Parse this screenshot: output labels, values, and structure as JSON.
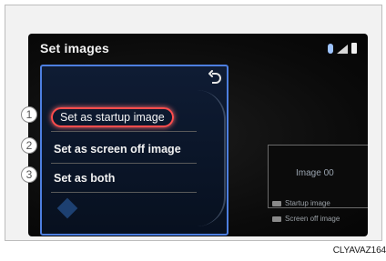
{
  "screen": {
    "title": "Set images"
  },
  "menu": {
    "items": [
      {
        "label": "Set as startup image",
        "selected": true,
        "callout": "1"
      },
      {
        "label": "Set as screen off image",
        "selected": false,
        "callout": "2"
      },
      {
        "label": "Set as both",
        "selected": false,
        "callout": "3"
      }
    ]
  },
  "preview": {
    "image_text": "Image 00"
  },
  "legend": {
    "startup": "Startup image",
    "screen_off": "Screen off image"
  },
  "caption": "CLYAVAZ164",
  "icons": {
    "back": "back-arrow-icon",
    "bluetooth": "bluetooth-icon",
    "signal": "signal-icon",
    "battery": "battery-icon"
  },
  "colors": {
    "panel_border": "#4d7fe0",
    "selection_outline": "#ff4d4d"
  }
}
